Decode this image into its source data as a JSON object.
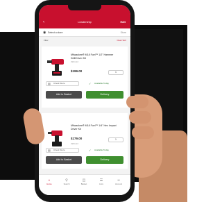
{
  "app": {
    "title": "Leadership",
    "edit_label": "Edit",
    "back_icon": "chevron-left-icon",
    "brand_color": "#c8102e",
    "button_green": "#3f8f2f",
    "button_dark": "#4b4b4b"
  },
  "location": {
    "label": "Select a store",
    "right_label": "Store"
  },
  "filter": {
    "left_label": "Filter",
    "right_label": "Clear  Sort"
  },
  "cards": [
    {
      "name": "Milwaukee® M18 Fuel™ 1/2\" Hammer Drill/Driver Kit",
      "sku": "2904-22",
      "price": "$199.00",
      "qty": "1",
      "option_left": "Check Store",
      "option_right": "Available Today",
      "secondary_button": "Add to Basket",
      "primary_button": "Delivery"
    },
    {
      "name": "Milwaukee® M18 Fuel™ 1/4\" Hex Impact Driver Kit",
      "sku": "2953-22",
      "price": "$179.00",
      "qty": "1",
      "option_left": "Check Store",
      "option_right": "Available Today",
      "secondary_button": "Add to Basket",
      "primary_button": "Delivery"
    }
  ],
  "tabs": [
    {
      "label": "Home",
      "icon": "home-icon"
    },
    {
      "label": "Search",
      "icon": "search-icon"
    },
    {
      "label": "Basket",
      "icon": "basket-icon"
    },
    {
      "label": "Lists",
      "icon": "list-icon"
    },
    {
      "label": "Account",
      "icon": "account-icon"
    }
  ]
}
